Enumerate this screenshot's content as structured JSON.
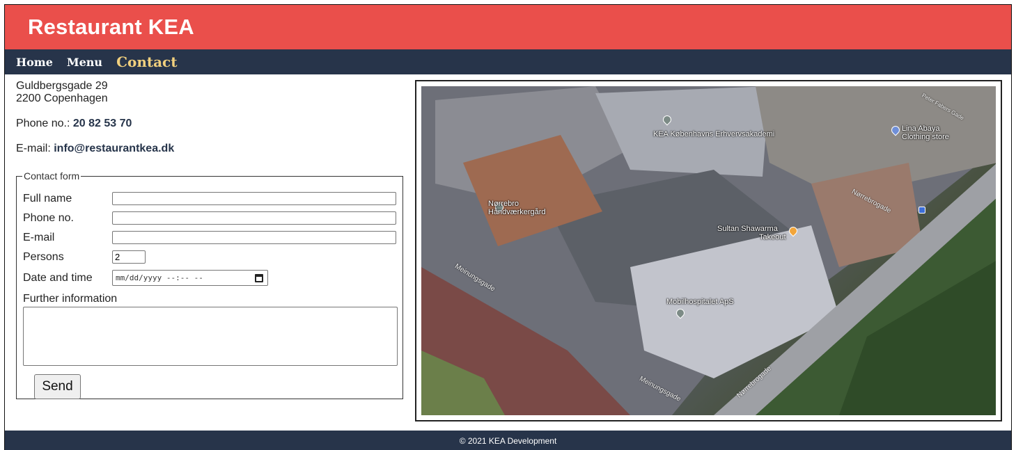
{
  "header": {
    "title": "Restaurant KEA"
  },
  "nav": {
    "items": [
      "Home",
      "Menu",
      "Contact"
    ],
    "active": "Contact"
  },
  "contact": {
    "address_line1": "Guldbergsgade 29",
    "address_line2": "2200 Copenhagen",
    "phone_label": "Phone no.:",
    "phone_value": "20 82 53 70",
    "email_label": "E-mail:",
    "email_value": "info@restaurantkea.dk"
  },
  "form": {
    "legend": "Contact form",
    "full_name_label": "Full name",
    "full_name_value": "",
    "phone_label": "Phone no.",
    "phone_value": "",
    "email_label": "E-mail",
    "email_value": "",
    "persons_label": "Persons",
    "persons_value": "2",
    "datetime_label": "Date and time",
    "datetime_placeholder": "mm/dd/yyyy --:-- --",
    "further_label": "Further information",
    "further_value": "",
    "send_label": "Send"
  },
  "map": {
    "labels": [
      {
        "text": "KEA Københavns Erhvervsakademi"
      },
      {
        "text": "Lina Abaya",
        "sub": "Clothing store"
      },
      {
        "text": "Nørrebro Håndværkergård"
      },
      {
        "text": "Sultan Shawarma",
        "sub": "Takeout"
      },
      {
        "text": "Mobilhospitalet ApS"
      }
    ],
    "streets": [
      "Meinungsgade",
      "Meinungsgade",
      "Nørrebrogade",
      "Nørrebrogade",
      "Peter Fabers Gade"
    ],
    "icons": {
      "place": "place-pin-icon",
      "food": "fork-knife-icon",
      "shop": "shopping-bag-icon",
      "bus": "bus-stop-icon"
    }
  },
  "footer": {
    "text": "© 2021 KEA Development"
  },
  "colors": {
    "header": "#ea4f4b",
    "nav": "#27344a",
    "active_link": "#f1d07e",
    "footer": "#27344a"
  }
}
